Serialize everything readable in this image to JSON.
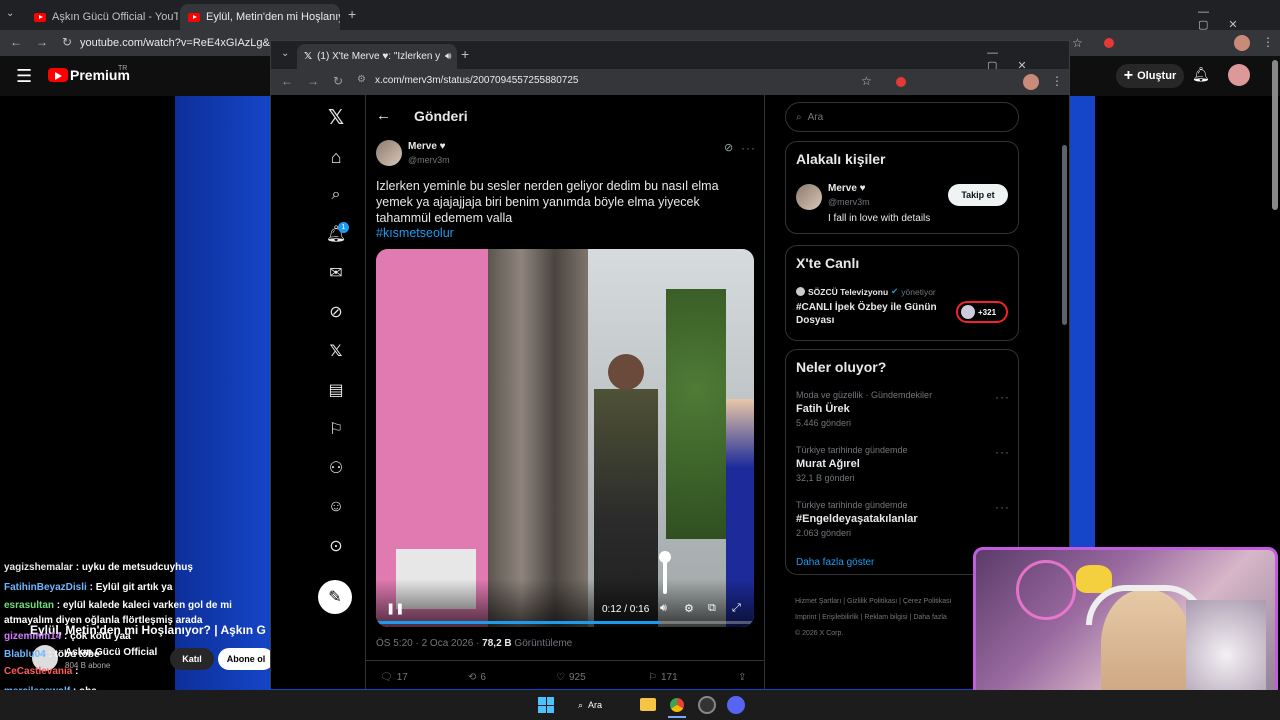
{
  "bg_browser": {
    "tabs": [
      {
        "label": "Aşkın Gücü Official - YouTube"
      },
      {
        "label": "Eylül, Metin'den mi Hoşlanıyor? |"
      }
    ],
    "url": "youtube.com/watch?v=ReE4xGIAzLg&list"
  },
  "youtube": {
    "brand": "Premium",
    "region": "TR",
    "create_label": "Oluştur",
    "video_title": "Eylül, Metin'den mi Hoşlanıyor? | Aşkın G",
    "channel_name": "Aşkın Gücü Official",
    "subscribers": "804 B abone",
    "join_label": "Katıl",
    "subscribe_label": "Abone ol"
  },
  "x_browser": {
    "tab_label": "(1) X'te Merve ♥: \"Izlerken y",
    "url": "x.com/merv3m/status/2007094557255880725"
  },
  "x_nav": {
    "notification_count": "1"
  },
  "post": {
    "header_title": "Gönderi",
    "author_name": "Merve ♥",
    "author_handle": "@merv3m",
    "text": "Izlerken yeminle bu sesler nerden geliyor dedim bu nasıl elma yemek ya ajajajjaja biri benim yanımda böyle elma yiyecek tahammül edemem valla",
    "hashtag": "#kısmetseolur",
    "video_time": "0:12 / 0:16",
    "video_progress": 0.75,
    "time": "ÖS 5:20 · 2 Oca 2026 · ",
    "views_count": "78,2 B",
    "views_label": " Görüntüleme",
    "replies": "17",
    "reposts": "6",
    "likes": "925",
    "bookmarks": "171"
  },
  "sidebar": {
    "search_placeholder": "Ara",
    "related_title": "Alakalı kişiler",
    "related_name": "Merve ♥",
    "related_handle": "@merv3m",
    "related_bio": "I fall in love with details",
    "follow_label": "Takip et",
    "live_title": "X'te Canlı",
    "live_host": "SÖZCÜ Televizyonu",
    "live_status": "yönetiyor",
    "live_text": "#CANLI İpek Özbey ile Günün Dosyası",
    "live_count": "+321",
    "trends_title": "Neler oluyor?",
    "trends": [
      {
        "context": "Moda ve güzellik · Gündemdekiler",
        "name": "Fatih Ürek",
        "count": "5.446 gönderi"
      },
      {
        "context": "Türkiye tarihinde gündemde",
        "name": "Murat Ağırel",
        "count": "32,1 B gönderi"
      },
      {
        "context": "Türkiye tarihinde gündemde",
        "name": "#Engeldeyaşatakılanlar",
        "count": "2.063 gönderi"
      }
    ],
    "show_more": "Daha fazla göster",
    "footer": [
      "Hizmet Şartları",
      "Gizlilik Politikası",
      "Çerez Politikası",
      "Imprint",
      "Erişilebilirlik",
      "Reklam bilgisi",
      "Daha fazla"
    ],
    "copyright": "© 2026 X Corp."
  },
  "chat": [
    {
      "user": "yagizshemalar",
      "msg": " : uyku de metsudcuyhuş",
      "color": "#e6e6e6"
    },
    {
      "user": "FatihinBeyazDisli",
      "msg": " : Eylül git artık ya",
      "color": "#6fb6ff"
    },
    {
      "user": "esrasultan",
      "msg": " : eylül kalede kaleci varken gol de mi",
      "color": "#6ee07a"
    },
    {
      "user": "",
      "msg": "atmayalım diyen oğlanla flörtleşmiş arada",
      "color": "#e6e6e6"
    },
    {
      "user": "gizemmm14",
      "msg": " : çok kötü yaa",
      "color": "#d07cff"
    },
    {
      "user": "Blablu04",
      "msg": " : töbe töbe",
      "color": "#6fb6ff"
    },
    {
      "user": "CeCastlevania",
      "msg": " :",
      "color": "#ff5a5a"
    },
    {
      "user": "mercilesswolf",
      "msg": " : oha",
      "color": "#6fb6ff"
    },
    {
      "user": "CeCastlevania",
      "msg": " :",
      "color": "#ff5a5a"
    }
  ],
  "taskbar": {
    "search_label": "Ara"
  },
  "colors": {
    "x_accent": "#1d9bf0",
    "youtube_red": "#ff0000",
    "webcam_border": "#c25de0"
  }
}
